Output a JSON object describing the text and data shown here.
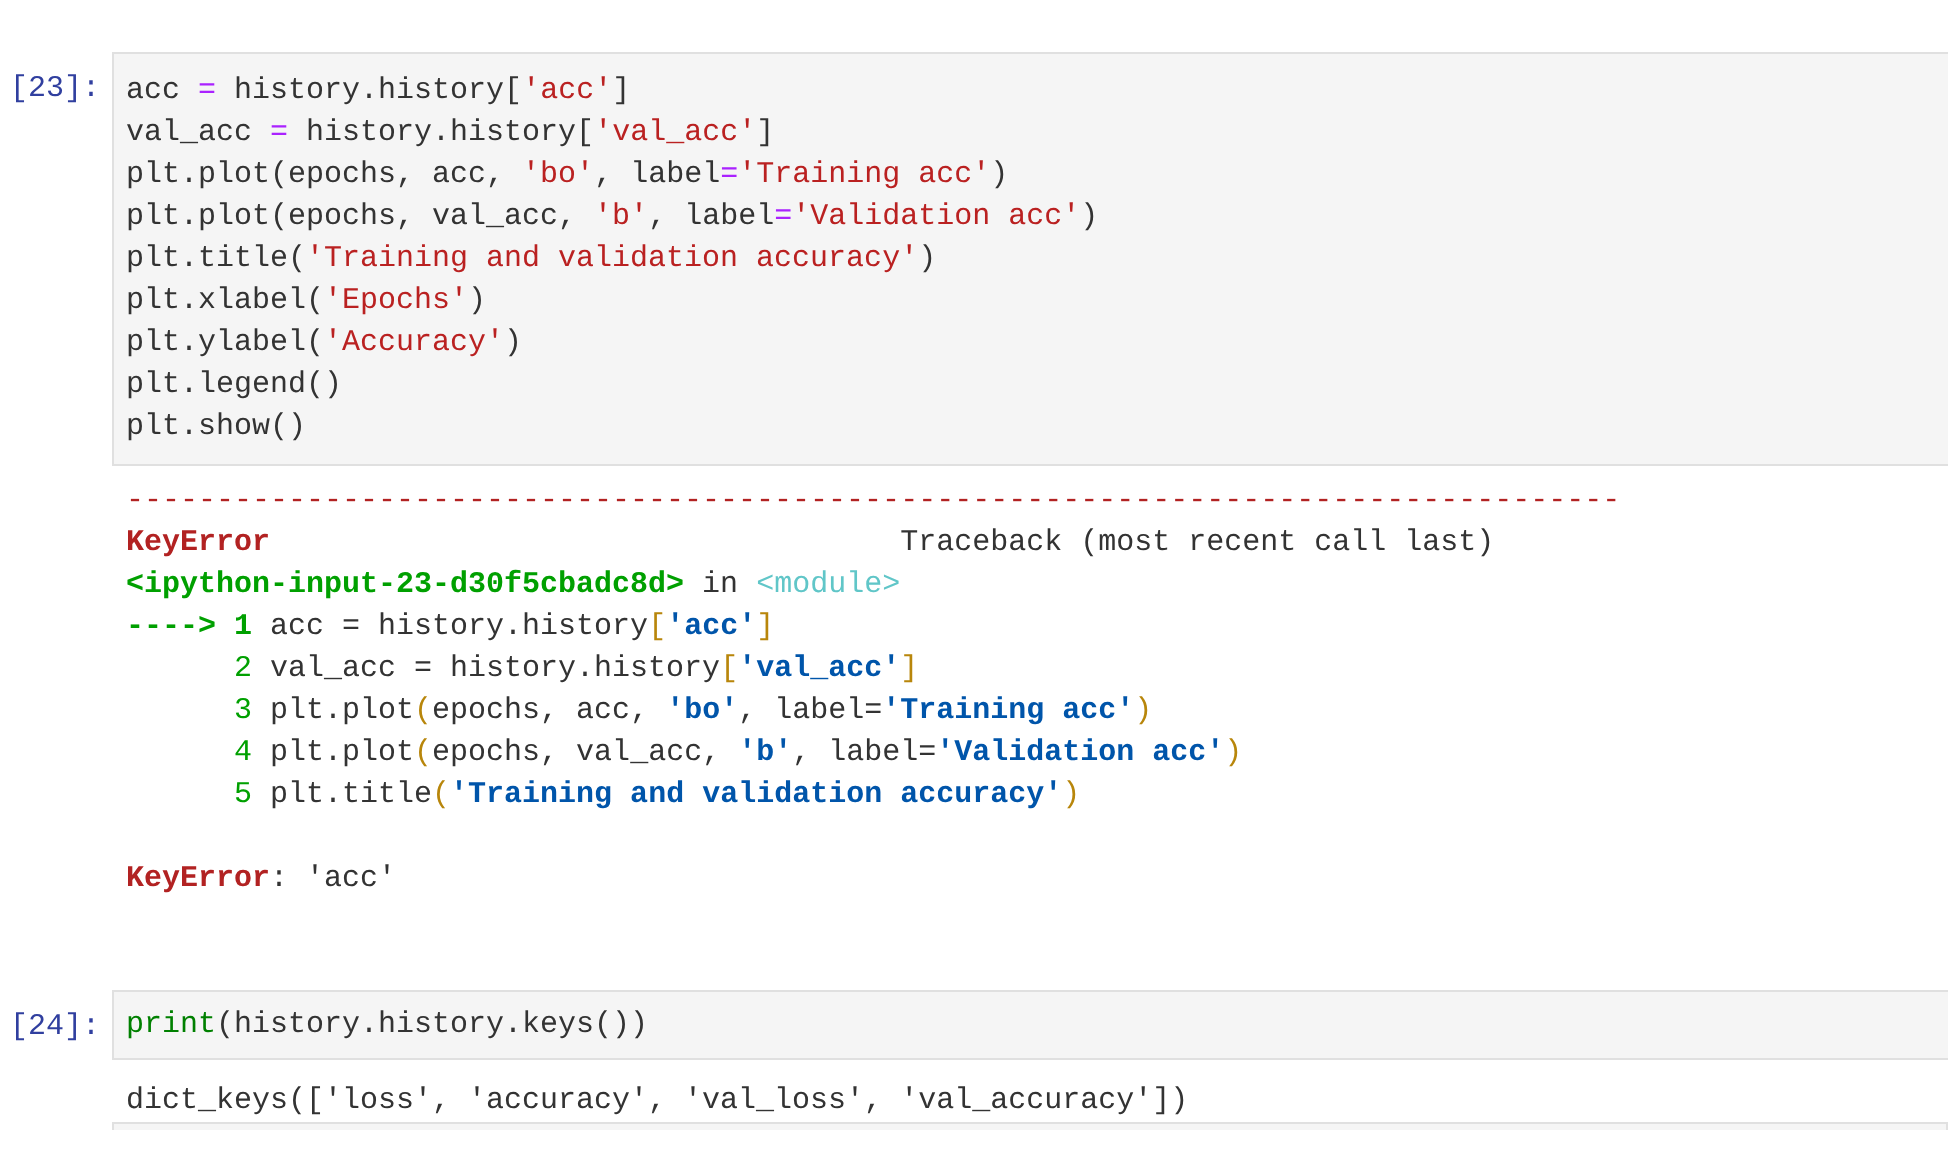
{
  "cells": [
    {
      "prompt": "[23]:",
      "input": [
        [
          {
            "kind": "plain",
            "t": "acc "
          },
          {
            "kind": "op",
            "t": "="
          },
          {
            "kind": "plain",
            "t": " history.history["
          },
          {
            "kind": "str",
            "t": "'acc'"
          },
          {
            "kind": "plain",
            "t": "]"
          }
        ],
        [
          {
            "kind": "plain",
            "t": "val_acc "
          },
          {
            "kind": "op",
            "t": "="
          },
          {
            "kind": "plain",
            "t": " history.history["
          },
          {
            "kind": "str",
            "t": "'val_acc'"
          },
          {
            "kind": "plain",
            "t": "]"
          }
        ],
        [
          {
            "kind": "plain",
            "t": "plt.plot(epochs, acc, "
          },
          {
            "kind": "str",
            "t": "'bo'"
          },
          {
            "kind": "plain",
            "t": ", label"
          },
          {
            "kind": "op",
            "t": "="
          },
          {
            "kind": "str",
            "t": "'Training acc'"
          },
          {
            "kind": "plain",
            "t": ")"
          }
        ],
        [
          {
            "kind": "plain",
            "t": "plt.plot(epochs, val_acc, "
          },
          {
            "kind": "str",
            "t": "'b'"
          },
          {
            "kind": "plain",
            "t": ", label"
          },
          {
            "kind": "op",
            "t": "="
          },
          {
            "kind": "str",
            "t": "'Validation acc'"
          },
          {
            "kind": "plain",
            "t": ")"
          }
        ],
        [
          {
            "kind": "plain",
            "t": "plt.title("
          },
          {
            "kind": "str",
            "t": "'Training and validation accuracy'"
          },
          {
            "kind": "plain",
            "t": ")"
          }
        ],
        [
          {
            "kind": "plain",
            "t": "plt.xlabel("
          },
          {
            "kind": "str",
            "t": "'Epochs'"
          },
          {
            "kind": "plain",
            "t": ")"
          }
        ],
        [
          {
            "kind": "plain",
            "t": "plt.ylabel("
          },
          {
            "kind": "str",
            "t": "'Accuracy'"
          },
          {
            "kind": "plain",
            "t": ")"
          }
        ],
        [
          {
            "kind": "plain",
            "t": "plt.legend()"
          }
        ],
        [
          {
            "kind": "plain",
            "t": "plt.show()"
          }
        ]
      ],
      "output": {
        "kind": "error",
        "traceback": [
          [
            {
              "kind": "err",
              "t": "-----------------------------------------------------------------------------------"
            }
          ],
          [
            {
              "kind": "errb",
              "t": "KeyError"
            },
            {
              "kind": "plain",
              "t": "                                   Traceback (most recent call last)"
            }
          ],
          [
            {
              "kind": "file",
              "t": "<ipython-input-23-d30f5cbadc8d>"
            },
            {
              "kind": "plain",
              "t": " in "
            },
            {
              "kind": "module",
              "t": "<module>"
            }
          ],
          [
            {
              "kind": "arrow",
              "t": "----> 1"
            },
            {
              "kind": "plain",
              "t": " acc = history.history"
            },
            {
              "kind": "paren",
              "t": "["
            },
            {
              "kind": "tbstr",
              "t": "'acc'"
            },
            {
              "kind": "paren",
              "t": "]"
            }
          ],
          [
            {
              "kind": "lineno",
              "t": "      2"
            },
            {
              "kind": "plain",
              "t": " val_acc = history.history"
            },
            {
              "kind": "paren",
              "t": "["
            },
            {
              "kind": "tbstr",
              "t": "'val_acc'"
            },
            {
              "kind": "paren",
              "t": "]"
            }
          ],
          [
            {
              "kind": "lineno",
              "t": "      3"
            },
            {
              "kind": "plain",
              "t": " plt.plot"
            },
            {
              "kind": "paren",
              "t": "("
            },
            {
              "kind": "plain",
              "t": "epochs, acc, "
            },
            {
              "kind": "tbstr",
              "t": "'bo'"
            },
            {
              "kind": "plain",
              "t": ", label="
            },
            {
              "kind": "tbstr",
              "t": "'Training acc'"
            },
            {
              "kind": "paren",
              "t": ")"
            }
          ],
          [
            {
              "kind": "lineno",
              "t": "      4"
            },
            {
              "kind": "plain",
              "t": " plt.plot"
            },
            {
              "kind": "paren",
              "t": "("
            },
            {
              "kind": "plain",
              "t": "epochs, val_acc, "
            },
            {
              "kind": "tbstr",
              "t": "'b'"
            },
            {
              "kind": "plain",
              "t": ", label="
            },
            {
              "kind": "tbstr",
              "t": "'Validation acc'"
            },
            {
              "kind": "paren",
              "t": ")"
            }
          ],
          [
            {
              "kind": "lineno",
              "t": "      5"
            },
            {
              "kind": "plain",
              "t": " plt.title"
            },
            {
              "kind": "paren",
              "t": "("
            },
            {
              "kind": "tbstr",
              "t": "'Training and validation accuracy'"
            },
            {
              "kind": "paren",
              "t": ")"
            }
          ]
        ],
        "message": [
          {
            "kind": "errb",
            "t": "KeyError"
          },
          {
            "kind": "plain",
            "t": ": 'acc'"
          }
        ]
      }
    },
    {
      "prompt": "[24]:",
      "input": [
        [
          {
            "kind": "builtin",
            "t": "print"
          },
          {
            "kind": "plain",
            "t": "(history.history.keys())"
          }
        ]
      ],
      "output": {
        "kind": "stream",
        "lines": [
          [
            {
              "kind": "plain",
              "t": "dict_keys(['loss', 'accuracy', 'val_loss', 'val_accuracy'])"
            }
          ]
        ]
      }
    }
  ]
}
